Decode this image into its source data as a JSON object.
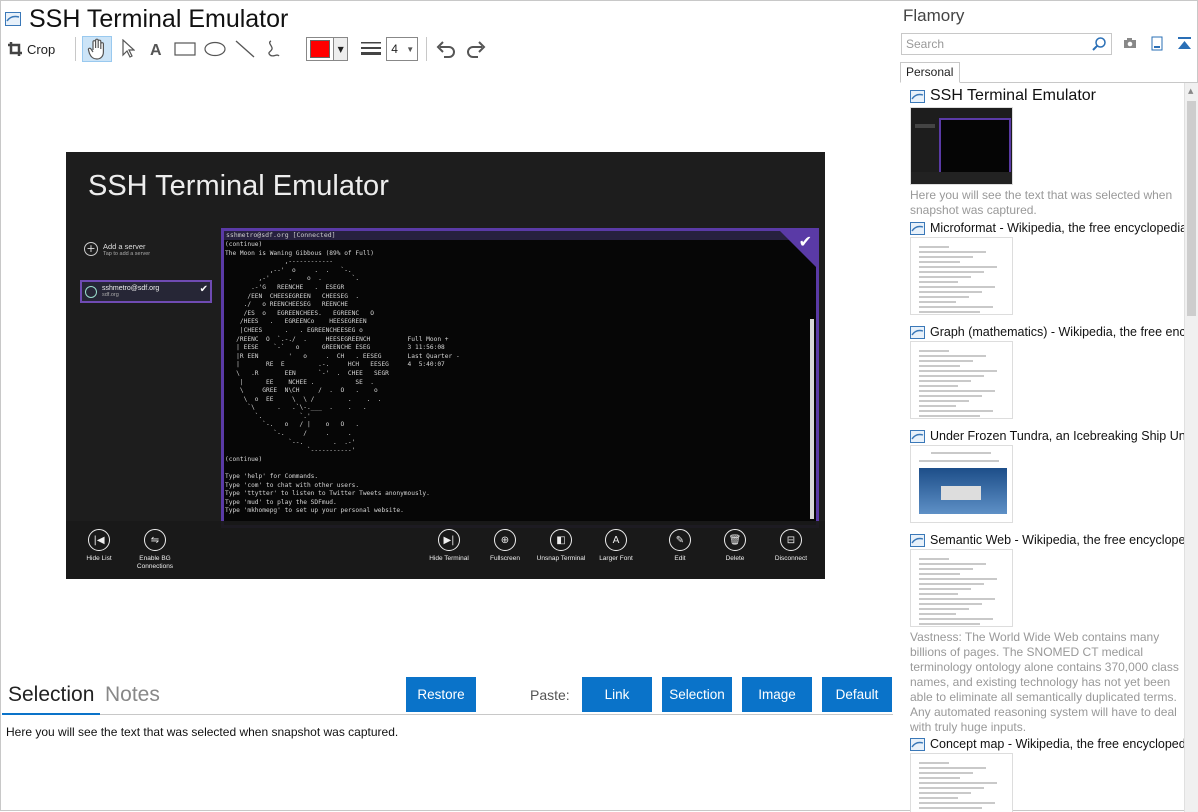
{
  "window": {
    "title": "SSH Terminal Emulator"
  },
  "toolbar": {
    "crop_label": "Crop",
    "color": "#ff0000",
    "line_width": "4"
  },
  "screenshot": {
    "app_title": "SSH Terminal Emulator",
    "add_server_label": "Add a server",
    "add_server_hint": "Tap to add a server",
    "server_name": "sshmetro@sdf.org",
    "server_host": "sdf.org",
    "terminal_header": "sshmetro@sdf.org [Connected]",
    "terminal_lines": [
      "(continue)",
      "The Moon is Waning Gibbous (89% of Full)",
      "                ,------------",
      "            ,--'  o     .  .   `-.",
      "         ,-'     .    o  .        `.",
      "       .-'G   REENCHE   .  ESEGR",
      "      /EEN  CHEESEGREEN   CHEESEG  .",
      "     ./   o REENCHEESEG   REENCHE",
      "     /ES  o   EGREENCHEES.   EGREENC   O",
      "    /HEES   .   EGREENCo    HEESEGREEN",
      "    |CHEES      .   . EGREENCHEESEG o",
      "   /REENC  O  `.-./  .     HEESEGREENCH          Full Moon +",
      "   | EESE    `-`   o      GREENCHE ESEG          3 11:56:08",
      "   |R EEN        '   o     .  CH   . EESEG       Last Quarter -",
      "   |       RE  E         .-.     HCH   EESEG     4  5:40:07",
      "   \\   .R       EEN      `-'  .  CHEE   SEGR",
      "    |      EE    NCHEE .           SE  .",
      "    \\     GREE  N\\CH     /  .  O   .    o",
      "     \\  o  EE     \\  \\ /         .    .  .",
      "      `\\      .   .`\\-.___  .    .   .",
      "        `.          `.'",
      "          `-.   o   / |    o   O   .",
      "             `-.     /     .     .",
      "                 `--.        .  .-'",
      "                      `-----------'",
      "(continue)",
      "",
      "Type 'help' for Commands.",
      "Type 'com' to chat with other users.",
      "Type 'ttytter' to listen to Twitter Tweets anonymously.",
      "Type 'mud' to play the SDFmud.",
      "Type 'mkhomepg' to set up your personal website."
    ],
    "appbar_left": [
      {
        "label": "Hide List",
        "icon": "hide-list-icon"
      },
      {
        "label": "Enable BG Connections",
        "icon": "bg-connections-icon"
      }
    ],
    "appbar_right": [
      {
        "label": "Hide Terminal",
        "icon": "hide-terminal-icon"
      },
      {
        "label": "Fullscreen",
        "icon": "fullscreen-icon"
      },
      {
        "label": "Unsnap Terminal",
        "icon": "unsnap-icon"
      },
      {
        "label": "Larger Font",
        "icon": "larger-font-icon"
      },
      {
        "label": "Edit",
        "icon": "edit-icon"
      },
      {
        "label": "Delete",
        "icon": "delete-icon"
      },
      {
        "label": "Disconnect",
        "icon": "disconnect-icon"
      }
    ]
  },
  "bottom": {
    "tab_selection": "Selection",
    "tab_notes": "Notes",
    "restore_label": "Restore",
    "paste_label": "Paste:",
    "paste_link": "Link",
    "paste_selection": "Selection",
    "paste_image": "Image",
    "paste_default": "Default",
    "selection_text": "Here you will see the text that was selected when snapshot was captured.",
    "accent": "#0a73c9"
  },
  "sidebar": {
    "title": "Flamory",
    "search_placeholder": "Search",
    "tab_personal": "Personal",
    "items": [
      {
        "title": "SSH Terminal Emulator",
        "desc": "Here you will see the text that was selected when snapshot was captured."
      },
      {
        "title": "Microformat - Wikipedia, the free encyclopedia",
        "desc": ""
      },
      {
        "title": "Graph (mathematics) - Wikipedia, the free encyclopedia",
        "desc": ""
      },
      {
        "title": "Under Frozen Tundra, an Icebreaking Ship Uncovers",
        "desc": ""
      },
      {
        "title": "Semantic Web - Wikipedia, the free encyclopedia",
        "desc": "Vastness: The World Wide Web contains many billions of pages. The SNOMED CT medical terminology ontology alone contains 370,000 class names, and existing technology has not yet been able to eliminate all semantically duplicated terms. Any automated reasoning system will have to deal with truly huge inputs."
      },
      {
        "title": "Concept map - Wikipedia, the free encyclopedia",
        "desc": ""
      }
    ]
  }
}
